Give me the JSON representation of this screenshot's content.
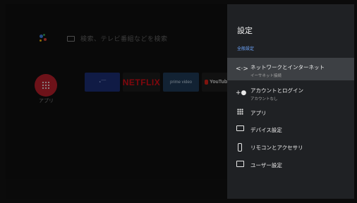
{
  "home": {
    "search_hint": "検索、テレビ番組などを検索",
    "apps_label": "アプリ",
    "tiles": [
      {
        "name": "tile-1",
        "label": "• ̄ ̄ ̄ ̄"
      },
      {
        "name": "netflix",
        "label": "NETFLIX"
      },
      {
        "name": "prime-video",
        "label": "prime video"
      },
      {
        "name": "youtube",
        "label": "YouTube"
      }
    ]
  },
  "settings": {
    "title": "設定",
    "section_label": "全般設定",
    "items": [
      {
        "label": "ネットワークとインターネット",
        "sublabel": "イーサネット接続",
        "icon": "network-icon"
      },
      {
        "label": "アカウントとログイン",
        "sublabel": "アカウントなし",
        "icon": "add-account-icon"
      },
      {
        "label": "アプリ",
        "icon": "apps-grid-icon"
      },
      {
        "label": "デバイス設定",
        "icon": "monitor-icon"
      },
      {
        "label": "リモコンとアクセサリ",
        "icon": "remote-icon"
      },
      {
        "label": "ユーザー設定",
        "icon": "user-settings-icon"
      }
    ]
  },
  "colors": {
    "accent_blue": "#6ea7ff",
    "apps_red": "#c21e2b",
    "panel_bg": "#1f2124",
    "selected_bg": "#3d4044"
  }
}
